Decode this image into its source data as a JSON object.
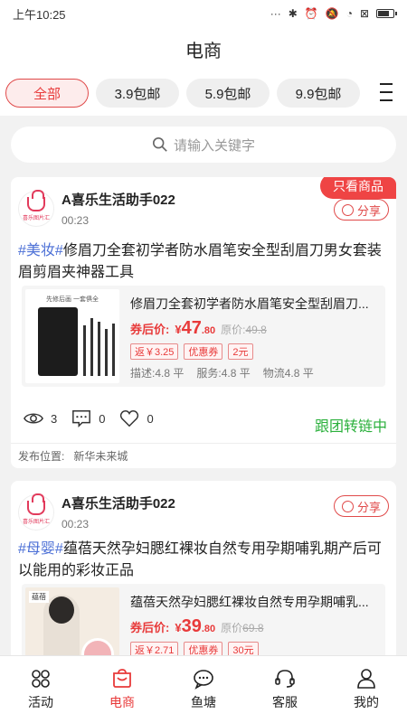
{
  "status": {
    "time": "上午10:25",
    "icons": [
      "dots-icon",
      "bluetooth-icon",
      "alarm-icon",
      "mute-icon",
      "wifi-icon",
      "sim-icon",
      "battery-icon"
    ]
  },
  "header": {
    "title": "电商"
  },
  "tabs": [
    {
      "label": "全部",
      "active": true
    },
    {
      "label": "3.9包邮"
    },
    {
      "label": "5.9包邮"
    },
    {
      "label": "9.9包邮"
    }
  ],
  "search": {
    "placeholder": "请输入关键字"
  },
  "cards": [
    {
      "ribbon": "只看商品",
      "avatar_text": "喜乐图片汇",
      "name": "A喜乐生活助手022",
      "time": "00:23",
      "share": "分享",
      "tag": "#美妆#",
      "title": "修眉刀全套初学者防水眉笔安全型刮眉刀男女套装眉剪眉夹神器工具",
      "product": {
        "name": "修眉刀全套初学者防水眉笔安全型刮眉刀...",
        "image_caption": "先修后画 一套俱全",
        "price_label": "券后价:",
        "currency": "¥",
        "price_int": "47",
        "price_dec": ".80",
        "orig_label": "原价:",
        "orig_price": "49.8",
        "rebate": "返￥3.25",
        "coupon_label": "优惠券",
        "coupon_value": "2元",
        "scores": [
          "描述:4.8 平",
          "服务:4.8 平",
          "物流4.8 平"
        ]
      },
      "views": "3",
      "comments": "0",
      "likes": "0",
      "follow": "跟团转链中",
      "location_label": "发布位置:",
      "location": "新华未来城"
    },
    {
      "avatar_text": "喜乐图片汇",
      "name": "A喜乐生活助手022",
      "time": "00:23",
      "share": "分享",
      "tag": "#母婴#",
      "title": "蕴蓓天然孕妇腮红裸妆自然专用孕期哺乳期产后可以能用的彩妆正品",
      "product": {
        "name": "蕴蓓天然孕妇腮红裸妆自然专用孕期哺乳...",
        "image_caption": "蕴蓓",
        "price_label": "券后价:",
        "currency": "¥",
        "price_int": "39",
        "price_dec": ".80",
        "orig_label": "原价",
        "orig_price": "69.8",
        "rebate": "返￥2.71",
        "coupon_label": "优惠券",
        "coupon_value": "30元"
      }
    }
  ],
  "tabbar": [
    {
      "label": "活动",
      "icon": "grid-icon"
    },
    {
      "label": "电商",
      "icon": "shop-icon",
      "active": true
    },
    {
      "label": "鱼塘",
      "icon": "chat-icon"
    },
    {
      "label": "客服",
      "icon": "headset-icon"
    },
    {
      "label": "我的",
      "icon": "person-icon"
    }
  ],
  "colors": {
    "accent": "#e83a3a",
    "follow": "#2bb03c",
    "tag": "#4b6fd6"
  }
}
